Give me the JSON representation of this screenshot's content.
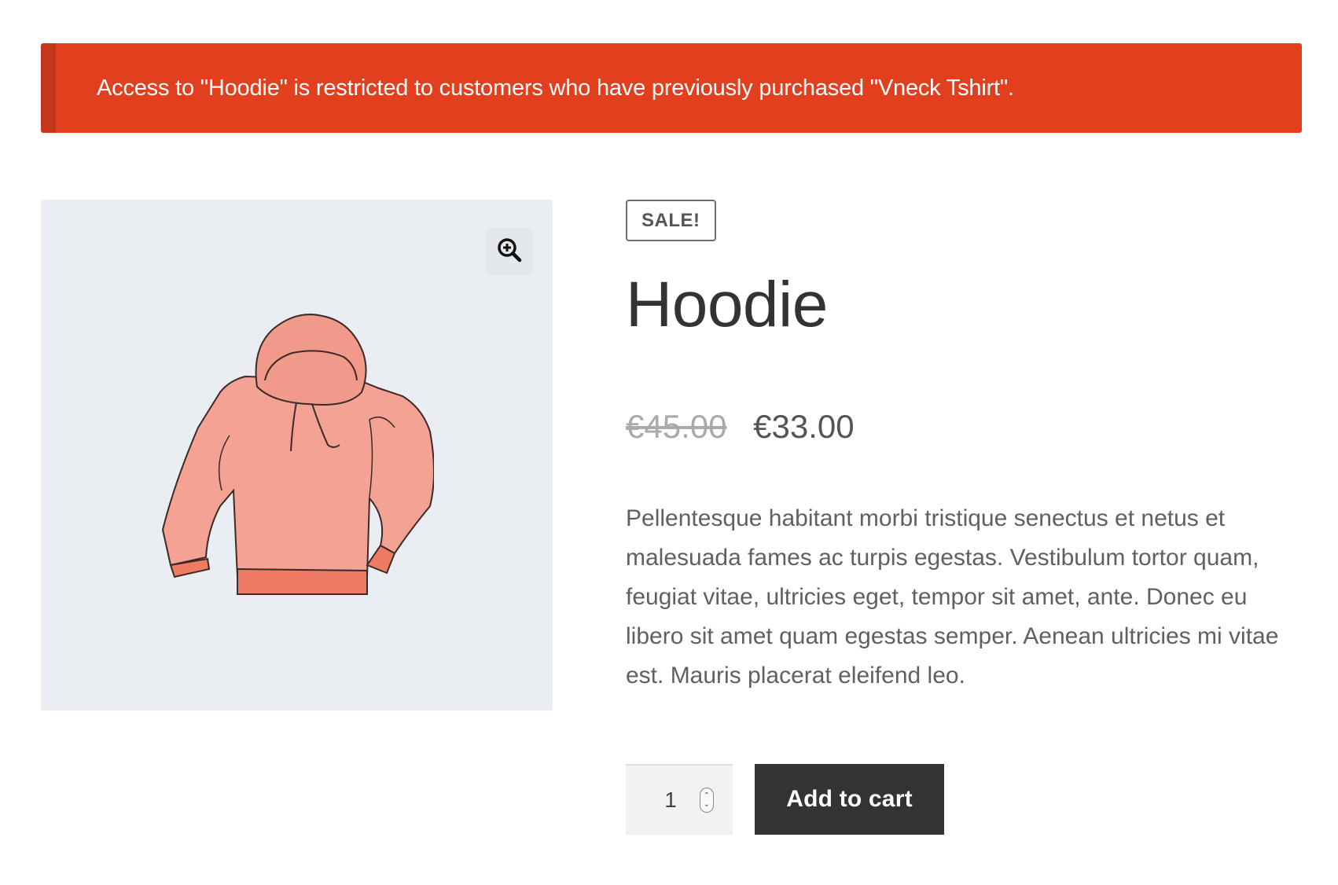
{
  "notice": {
    "message": "Access to \"Hoodie\" is restricted to customers who have previously purchased \"Vneck Tshirt\"."
  },
  "gallery": {
    "zoom_icon": "zoom-in-icon",
    "image_alt": "Hoodie"
  },
  "product": {
    "badge": "SALE!",
    "title": "Hoodie",
    "price_old": "€45.00",
    "price_new": "€33.00",
    "description": "Pellentesque habitant morbi tristique senectus et netus et malesuada fames ac turpis egestas. Vestibulum tortor quam, feugiat vitae, ultricies eget, tempor sit amet, ante. Donec eu libero sit amet quam egestas semper. Aenean ultricies mi vitae est. Mauris placerat eleifend leo."
  },
  "cart": {
    "quantity": "1",
    "add_label": "Add to cart"
  },
  "colors": {
    "notice_bg": "#e23f1e",
    "button_bg": "#333333",
    "gallery_bg": "#eaeef2"
  }
}
